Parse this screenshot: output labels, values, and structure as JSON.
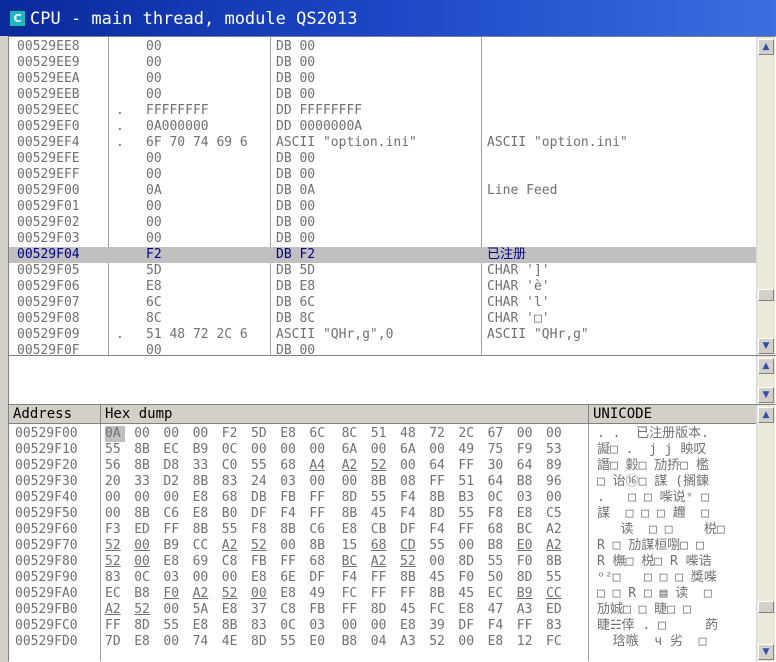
{
  "window": {
    "title": "CPU - main thread, module QS2013",
    "icon_label": "C"
  },
  "disasm": {
    "rows": [
      {
        "addr": "00529EE8",
        "mark": "",
        "bytes": "00",
        "instr": "DB 00",
        "comment": ""
      },
      {
        "addr": "00529EE9",
        "mark": "",
        "bytes": "00",
        "instr": "DB 00",
        "comment": ""
      },
      {
        "addr": "00529EEA",
        "mark": "",
        "bytes": "00",
        "instr": "DB 00",
        "comment": ""
      },
      {
        "addr": "00529EEB",
        "mark": "",
        "bytes": "00",
        "instr": "DB 00",
        "comment": ""
      },
      {
        "addr": "00529EEC",
        "mark": ".",
        "bytes": "FFFFFFFF",
        "instr": "DD FFFFFFFF",
        "comment": ""
      },
      {
        "addr": "00529EF0",
        "mark": ".",
        "bytes": "0A000000",
        "instr": "DD 0000000A",
        "comment": ""
      },
      {
        "addr": "00529EF4",
        "mark": ".",
        "bytes": "6F 70 74 69 6",
        "instr": "ASCII \"option.ini\"",
        "comment": "ASCII \"option.ini\""
      },
      {
        "addr": "00529EFE",
        "mark": "",
        "bytes": "00",
        "instr": "DB 00",
        "comment": ""
      },
      {
        "addr": "00529EFF",
        "mark": "",
        "bytes": "00",
        "instr": "DB 00",
        "comment": ""
      },
      {
        "addr": "00529F00",
        "mark": "",
        "bytes": "0A",
        "instr": "DB 0A",
        "comment": "Line Feed"
      },
      {
        "addr": "00529F01",
        "mark": "",
        "bytes": "00",
        "instr": "DB 00",
        "comment": ""
      },
      {
        "addr": "00529F02",
        "mark": "",
        "bytes": "00",
        "instr": "DB 00",
        "comment": ""
      },
      {
        "addr": "00529F03",
        "mark": "",
        "bytes": "00",
        "instr": "DB 00",
        "comment": ""
      },
      {
        "addr": "00529F04",
        "mark": "",
        "bytes": "F2",
        "instr": "DB F2",
        "comment": "已注册",
        "selected": true
      },
      {
        "addr": "00529F05",
        "mark": "",
        "bytes": "5D",
        "instr": "DB 5D",
        "comment": "CHAR ']'"
      },
      {
        "addr": "00529F06",
        "mark": "",
        "bytes": "E8",
        "instr": "DB E8",
        "comment": "CHAR 'è'"
      },
      {
        "addr": "00529F07",
        "mark": "",
        "bytes": "6C",
        "instr": "DB 6C",
        "comment": "CHAR 'l'"
      },
      {
        "addr": "00529F08",
        "mark": "",
        "bytes": "8C",
        "instr": "DB 8C",
        "comment": "CHAR '□'"
      },
      {
        "addr": "00529F09",
        "mark": ".",
        "bytes": "51 48 72 2C 6",
        "instr": "ASCII \"QHr,g\",0",
        "comment": "ASCII \"QHr,g\""
      },
      {
        "addr": "00529F0F",
        "mark": "",
        "bytes": "00",
        "instr": "DB 00",
        "comment": ""
      }
    ]
  },
  "dump": {
    "headers": {
      "address": "Address",
      "hex": "Hex dump",
      "unicode": "UNICODE"
    },
    "rows": [
      {
        "addr": "00529F00",
        "hex": [
          "0A",
          "00",
          "00",
          "00",
          "F2",
          "5D",
          "E8",
          "6C",
          "8C",
          "51",
          "48",
          "72",
          "2C",
          "67",
          "00",
          "00"
        ],
        "uni": ". .  已注册版本."
      },
      {
        "addr": "00529F10",
        "hex": [
          "55",
          "8B",
          "EC",
          "B9",
          "0C",
          "00",
          "00",
          "00",
          "6A",
          "00",
          "6A",
          "00",
          "49",
          "75",
          "F9",
          "53"
        ],
        "uni": "譺□ .  j j 眏叹"
      },
      {
        "addr": "00529F20",
        "hex": [
          "56",
          "8B",
          "D8",
          "33",
          "C0",
          "55",
          "68",
          "A4",
          "A2",
          "52",
          "00",
          "64",
          "FF",
          "30",
          "64",
          "89"
        ],
        "uni": "譖□ 豰□ 劢挢□ 檻"
      },
      {
        "addr": "00529F30",
        "hex": [
          "20",
          "33",
          "D2",
          "8B",
          "83",
          "24",
          "03",
          "00",
          "00",
          "8B",
          "08",
          "FF",
          "51",
          "64",
          "B8",
          "96"
        ],
        "uni": "□ 诒⑯□ 謀 (搁鍊"
      },
      {
        "addr": "00529F40",
        "hex": [
          "00",
          "00",
          "00",
          "E8",
          "68",
          "DB",
          "FB",
          "FF",
          "8D",
          "55",
          "F4",
          "8B",
          "B3",
          "0C",
          "03",
          "00"
        ],
        "uni": ".   □ □ 喍说ᵛ □"
      },
      {
        "addr": "00529F50",
        "hex": [
          "00",
          "8B",
          "C6",
          "E8",
          "B0",
          "DF",
          "F4",
          "FF",
          "8B",
          "45",
          "F4",
          "8D",
          "55",
          "F8",
          "E8",
          "C5"
        ],
        "uni": "謀  □ □ □ 趰  □"
      },
      {
        "addr": "00529F60",
        "hex": [
          "F3",
          "ED",
          "FF",
          "8B",
          "55",
          "F8",
          "8B",
          "C6",
          "E8",
          "CB",
          "DF",
          "F4",
          "FF",
          "68",
          "BC",
          "A2"
        ],
        "uni": "   读  □ □    棁□"
      },
      {
        "addr": "00529F70",
        "hex": [
          "52",
          "00",
          "B9",
          "CC",
          "A2",
          "52",
          "00",
          "8B",
          "15",
          "68",
          "CD",
          "55",
          "00",
          "B8",
          "E0",
          "A2"
        ],
        "uni": "R □ 劢謀桓哵□ □"
      },
      {
        "addr": "00529F80",
        "hex": [
          "52",
          "00",
          "E8",
          "69",
          "C8",
          "FB",
          "FF",
          "68",
          "BC",
          "A2",
          "52",
          "00",
          "8D",
          "55",
          "F0",
          "8B"
        ],
        "uni": "R 橅□ 棁□ R 喍诰"
      },
      {
        "addr": "00529F90",
        "hex": [
          "83",
          "0C",
          "03",
          "00",
          "00",
          "E8",
          "6E",
          "DF",
          "F4",
          "FF",
          "8B",
          "45",
          "F0",
          "50",
          "8D",
          "55"
        ],
        "uni": "ᵒᶻ□   □ □ □ 獎喍"
      },
      {
        "addr": "00529FA0",
        "hex": [
          "EC",
          "B8",
          "F0",
          "A2",
          "52",
          "00",
          "E8",
          "49",
          "FC",
          "FF",
          "FF",
          "8B",
          "45",
          "EC",
          "B9",
          "CC"
        ],
        "uni": "□ □ R □ ▤ 读  □"
      },
      {
        "addr": "00529FB0",
        "hex": [
          "A2",
          "52",
          "00",
          "5A",
          "E8",
          "37",
          "C8",
          "FB",
          "FF",
          "8D",
          "45",
          "FC",
          "E8",
          "47",
          "A3",
          "ED"
        ],
        "uni": "劢娍□ □ 睫□ □"
      },
      {
        "addr": "00529FC0",
        "hex": [
          "FF",
          "8D",
          "55",
          "E8",
          "8B",
          "83",
          "0C",
          "03",
          "00",
          "00",
          "E8",
          "39",
          "DF",
          "F4",
          "FF",
          "83"
        ],
        "uni": "睫☵倖 . □     菂"
      },
      {
        "addr": "00529FD0",
        "hex": [
          "7D",
          "E8",
          "00",
          "74",
          "4E",
          "8D",
          "55",
          "E0",
          "B8",
          "04",
          "A3",
          "52",
          "00",
          "E8",
          "12",
          "FC"
        ],
        "uni": "  琀嗾  ч 劣  □"
      }
    ]
  }
}
